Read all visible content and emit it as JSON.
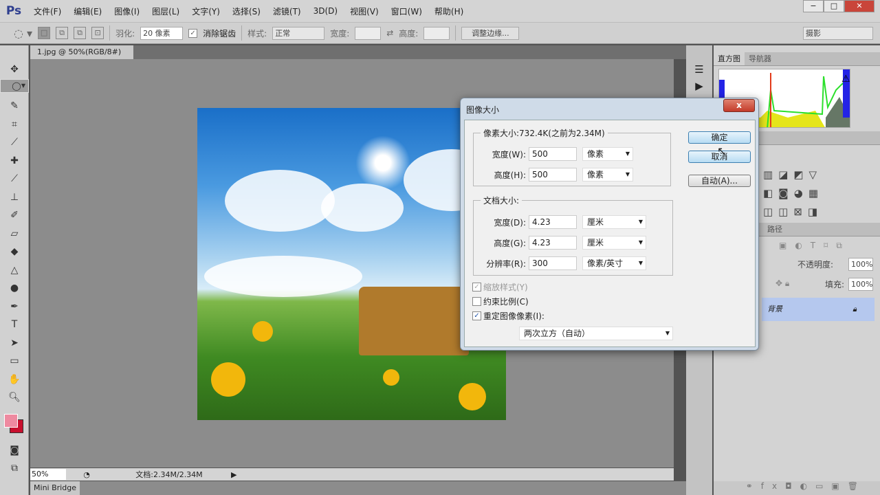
{
  "app": {
    "logo": "Ps",
    "menus": [
      "文件(F)",
      "编辑(E)",
      "图像(I)",
      "图层(L)",
      "文字(Y)",
      "选择(S)",
      "滤镜(T)",
      "3D(D)",
      "视图(V)",
      "窗口(W)",
      "帮助(H)"
    ],
    "window_controls": [
      "−",
      "□",
      "✕"
    ]
  },
  "options": {
    "feather_label": "羽化:",
    "feather_value": "20 像素",
    "antialias_label": "消除锯齿",
    "antialias_checked": true,
    "style_label": "样式:",
    "style_value": "正常",
    "width_label": "宽度:",
    "height_label": "高度:",
    "refine_edge": "调整边缘...",
    "workspace": "摄影"
  },
  "document": {
    "tab": "1.jpg @ 50%(RGB/8#)",
    "tab_close": "×"
  },
  "status": {
    "zoom": "50%",
    "doc_info": "文档:2.34M/2.34M",
    "mini_bridge": "Mini Bridge"
  },
  "tools": [
    "move",
    "marquee-ellipse",
    "lasso",
    "quick-select",
    "crop",
    "eyedropper",
    "healing-brush",
    "brush",
    "clone-stamp",
    "history-brush",
    "eraser",
    "paint-bucket",
    "blur",
    "dodge",
    "pen",
    "type",
    "path-select",
    "shape",
    "hand",
    "zoom"
  ],
  "panels": {
    "tabs": [
      "直方图",
      "导航器"
    ],
    "paths_tab": "路径",
    "opacity_label": "不透明度:",
    "opacity_value": "100%",
    "fill_label": "填充:",
    "fill_value": "100%",
    "layer_name": "背景"
  },
  "dialog": {
    "title": "图像大小",
    "close": "x",
    "pixel_dims_label": "像素大小:732.4K(之前为2.34M)",
    "width_label": "宽度(W):",
    "width_value": "500",
    "width_unit": "像素",
    "height_label": "高度(H):",
    "height_value": "500",
    "height_unit": "像素",
    "doc_size_label": "文档大小:",
    "doc_width_label": "宽度(D):",
    "doc_width_value": "4.23",
    "doc_width_unit": "厘米",
    "doc_height_label": "高度(G):",
    "doc_height_value": "4.23",
    "doc_height_unit": "厘米",
    "resolution_label": "分辨率(R):",
    "resolution_value": "300",
    "resolution_unit": "像素/英寸",
    "scale_styles": "缩放样式(Y)",
    "scale_styles_checked": true,
    "scale_styles_disabled": true,
    "constrain": "约束比例(C)",
    "constrain_checked": false,
    "resample": "重定图像像素(I):",
    "resample_checked": true,
    "resample_method": "两次立方（自动）",
    "ok": "确定",
    "cancel": "取消",
    "auto": "自动(A)..."
  }
}
